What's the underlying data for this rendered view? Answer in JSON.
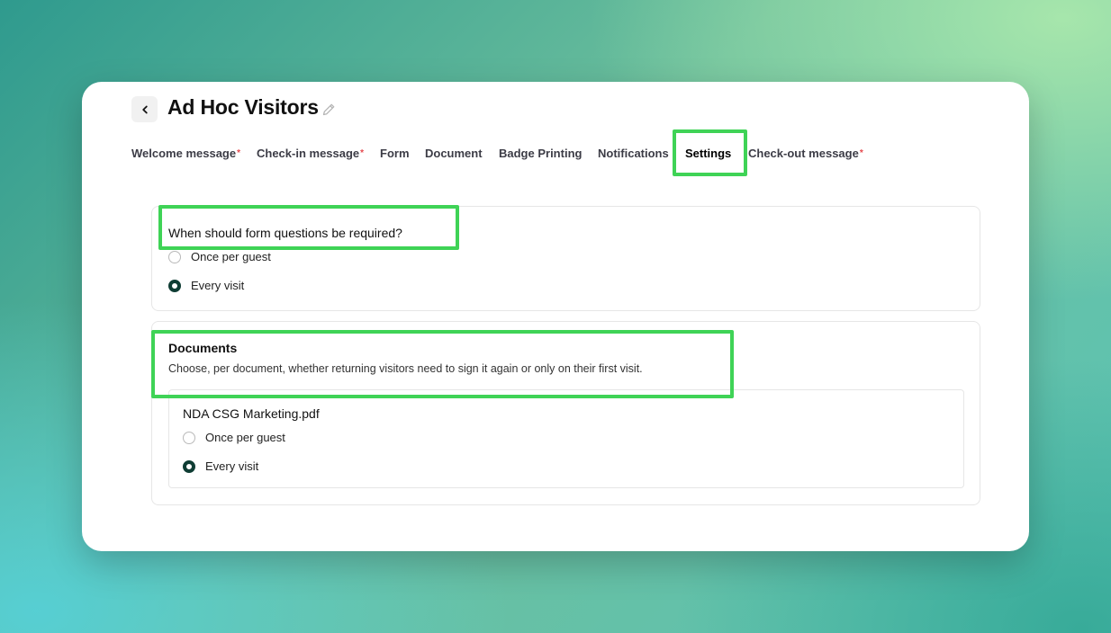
{
  "header": {
    "title": "Ad Hoc Visitors"
  },
  "tabs": [
    {
      "label": "Welcome message",
      "required": "*"
    },
    {
      "label": "Check-in message",
      "required": "*"
    },
    {
      "label": "Form",
      "required": ""
    },
    {
      "label": "Document",
      "required": ""
    },
    {
      "label": "Badge Printing",
      "required": ""
    },
    {
      "label": "Notifications",
      "required": ""
    },
    {
      "label": "Settings",
      "required": "",
      "active": true
    },
    {
      "label": "Check-out message",
      "required": "*"
    }
  ],
  "form_settings": {
    "question": "When should form questions be required?",
    "options": [
      {
        "label": "Once per guest",
        "selected": false
      },
      {
        "label": "Every visit",
        "selected": true
      }
    ]
  },
  "documents": {
    "heading": "Documents",
    "description": "Choose, per document, whether returning visitors need to sign it again or only on their first visit.",
    "items": [
      {
        "name": "NDA CSG Marketing.pdf",
        "options": [
          {
            "label": "Once per guest",
            "selected": false
          },
          {
            "label": "Every visit",
            "selected": true
          }
        ]
      }
    ]
  },
  "colors": {
    "highlight": "#3fd356",
    "radio_selected": "#0f3d34",
    "required_marker": "#e5484d"
  }
}
